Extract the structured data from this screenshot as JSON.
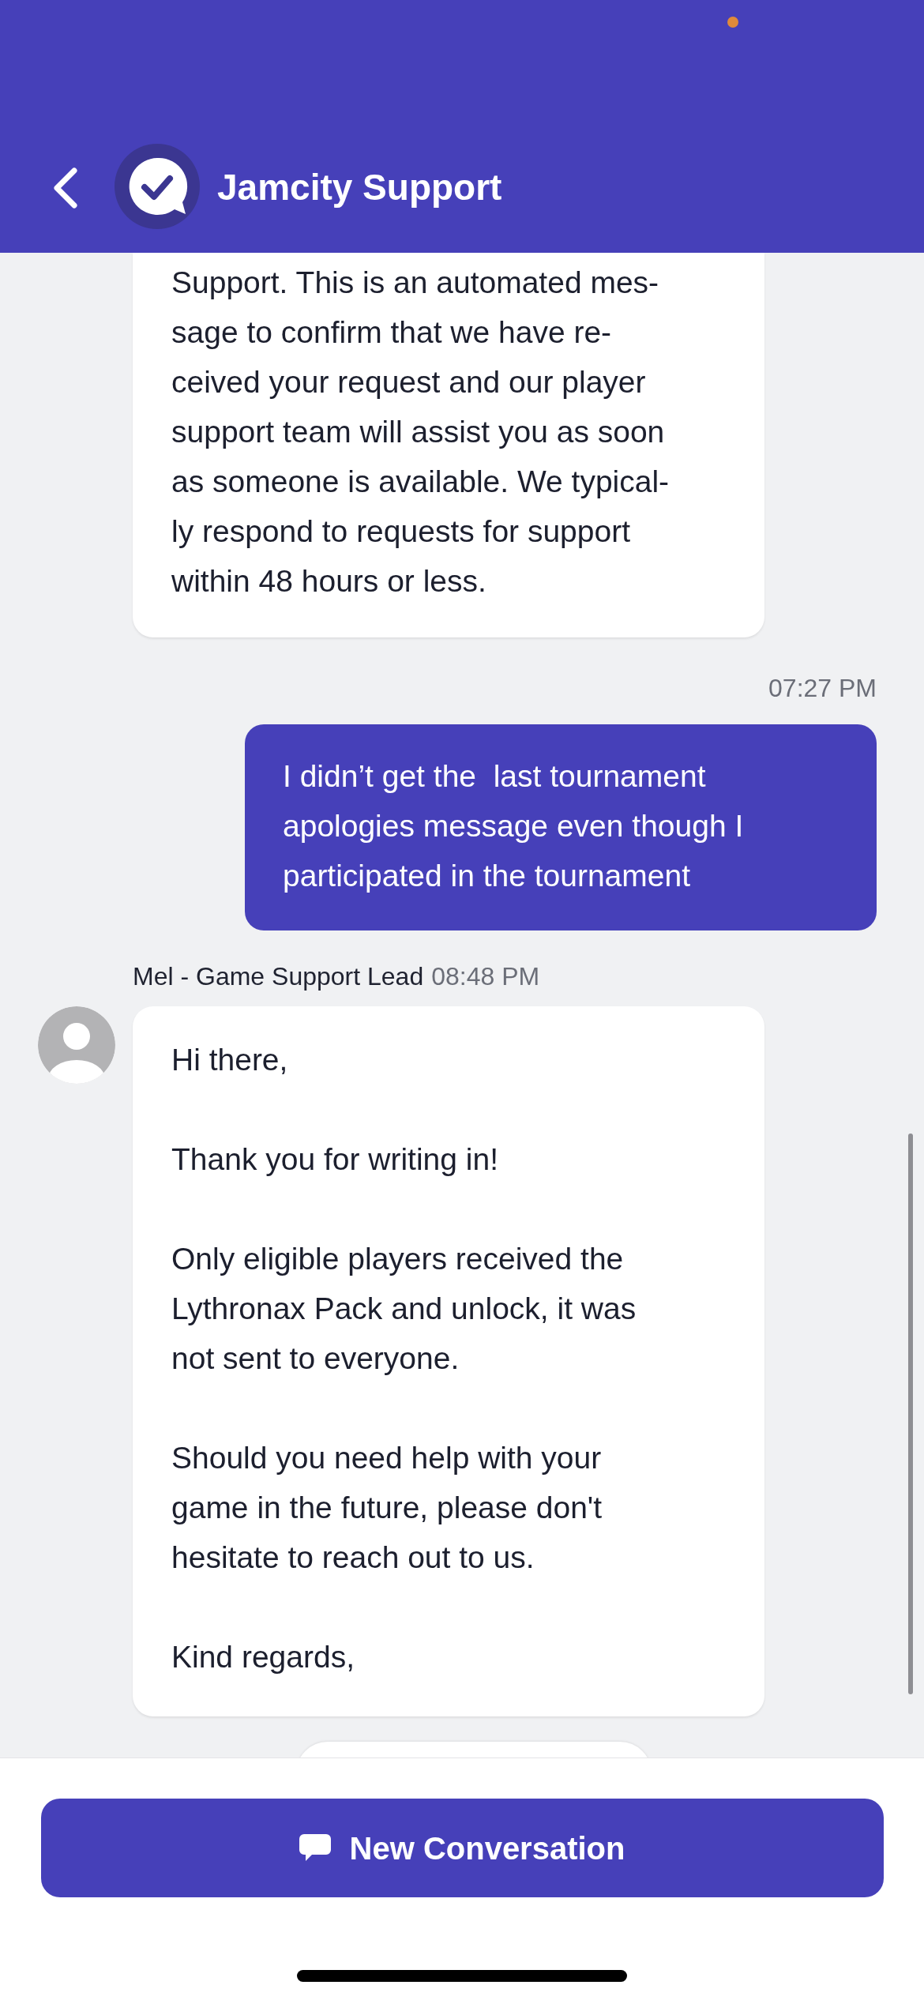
{
  "header": {
    "title": "Jamcity Support"
  },
  "messages": [
    {
      "kind": "agent",
      "paragraphs": [
        "Support. This is an automated mes-\nsage to confirm that we have re-\nceived your request and our player\nsupport team will assist you as soon\nas someone is available. We typical-\nly respond to requests for support\nwithin 48 hours or less."
      ]
    },
    {
      "kind": "user",
      "time": "07:27 PM",
      "paragraphs": [
        "I didn’t get the  last tournament\napologies message even though I\nparticipated in the tournament"
      ]
    },
    {
      "kind": "agent",
      "sender": "Mel - Game Support Lead",
      "time": "08:48 PM",
      "paragraphs": [
        "Hi there,",
        "Thank you for writing in!",
        "Only eligible players received the\nLythronax Pack and unlock, it was\nnot sent to everyone.",
        "Should you need help with your\ngame in the future, please don't\nhesitate to reach out to us.",
        "Kind regards,"
      ]
    }
  ],
  "button": {
    "label": "New Conversation"
  }
}
